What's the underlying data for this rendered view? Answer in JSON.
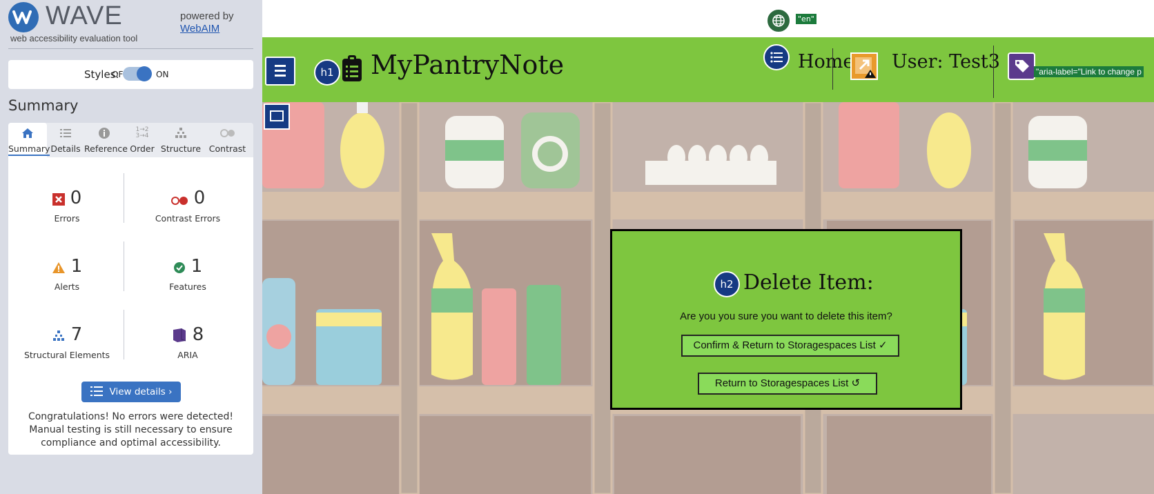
{
  "wave": {
    "logo_text": "WAVE",
    "tagline": "web accessibility evaluation tool",
    "powered_by": "powered by",
    "webaim_link": "WebAIM",
    "styles": {
      "label": "Styles:",
      "off": "OFF",
      "on": "ON",
      "state": "on"
    },
    "summary_heading": "Summary",
    "tabs": [
      {
        "label": "Summary",
        "icon": "home-icon",
        "active": true
      },
      {
        "label": "Details",
        "icon": "list-icon"
      },
      {
        "label": "Reference",
        "icon": "info-icon"
      },
      {
        "label": "Order",
        "icon": "order-icon"
      },
      {
        "label": "Structure",
        "icon": "structure-icon"
      },
      {
        "label": "Contrast",
        "icon": "contrast-icon"
      }
    ],
    "stats": {
      "errors": {
        "value": "0",
        "label": "Errors"
      },
      "contrast_errors": {
        "value": "0",
        "label": "Contrast Errors"
      },
      "alerts": {
        "value": "1",
        "label": "Alerts"
      },
      "features": {
        "value": "1",
        "label": "Features"
      },
      "structural": {
        "value": "7",
        "label": "Structural Elements"
      },
      "aria": {
        "value": "8",
        "label": "ARIA"
      }
    },
    "view_details": "View details ›",
    "congrats": "Congratulations! No errors were detected! Manual testing is still necessary to ensure compliance and optimal accessibility."
  },
  "site": {
    "lang_tag": "\"en\"",
    "brand": "MyPantryNote",
    "h1_badge": "h1",
    "nav_home": "Home",
    "nav_user": "User: Test3",
    "aria_label_text": "\"aria-label=\"Link to change p",
    "modal": {
      "h2_badge": "h2",
      "title": "Delete Item:",
      "text": "Are you you sure you want to delete this item?",
      "confirm": "Confirm & Return to Storagespaces List ✓",
      "return": "Return to Storagespaces List ↺"
    }
  },
  "colors": {
    "nav_green": "#7ec63f",
    "wave_blue": "#3a73c2",
    "badge_navy": "#163a83"
  }
}
